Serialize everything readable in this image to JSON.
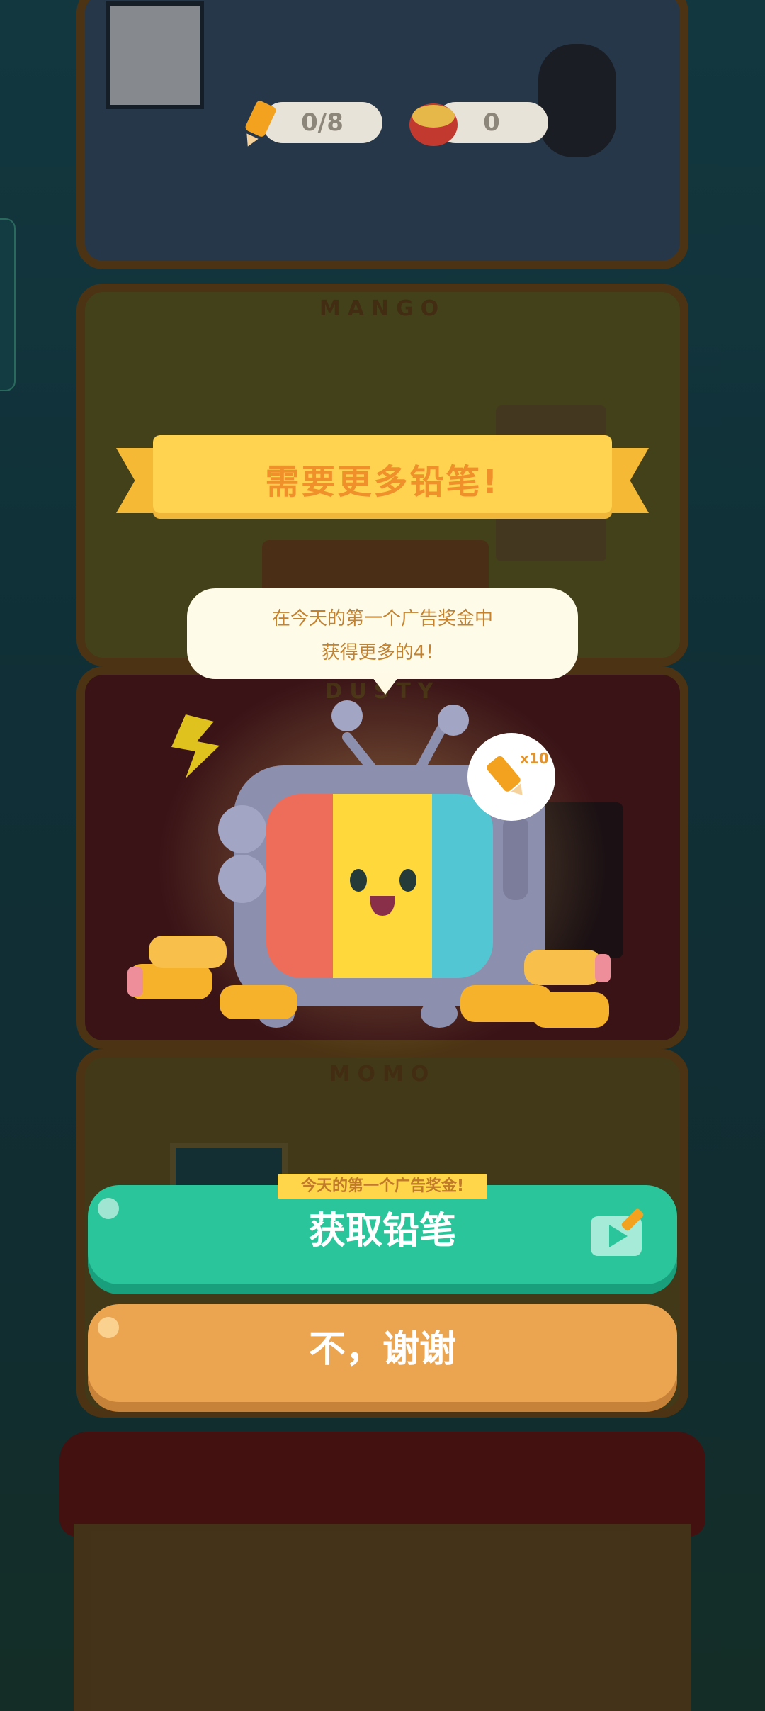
{
  "hud": {
    "pencils": "0/8",
    "cans": "0"
  },
  "floors": [
    "MANGO",
    "DUSTY",
    "MOMO"
  ],
  "ribbon": {
    "title": "需要更多铅笔!"
  },
  "bubble": {
    "line1": "在今天的第一个广告奖金中",
    "line2": "获得更多的4！"
  },
  "reward": {
    "multiplier": "x10"
  },
  "badge": {
    "text": "今天的第一个广告奖金!"
  },
  "buttons": {
    "get_pencils": "获取铅笔",
    "no_thanks": "不，谢谢"
  },
  "colors": {
    "ribbon": "#ffd24f",
    "ribbon_text": "#f0902a",
    "green_button": "#2bc59b",
    "orange_button": "#eba551",
    "bubble": "#fffbe9"
  }
}
